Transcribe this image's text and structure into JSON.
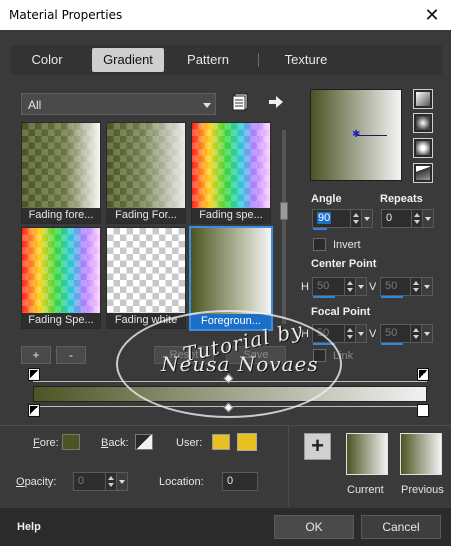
{
  "window": {
    "title": "Material Properties",
    "close_glyph": "✕"
  },
  "tabs": [
    {
      "label": "Color",
      "active": false
    },
    {
      "label": "Gradient",
      "active": true
    },
    {
      "label": "Pattern",
      "active": false
    },
    {
      "label": "Texture",
      "active": false
    }
  ],
  "category": {
    "selected": "All"
  },
  "gallery": [
    {
      "label": "Fading fore...",
      "selected": false
    },
    {
      "label": "Fading For...",
      "selected": false
    },
    {
      "label": "Fading spe...",
      "selected": false
    },
    {
      "label": "Fading Spe...",
      "selected": false
    },
    {
      "label": "Fading white",
      "selected": false
    },
    {
      "label": "Foregroun...",
      "selected": true
    }
  ],
  "style_icons": [
    "linear-style-icon",
    "rectangular-style-icon",
    "sunburst-style-icon",
    "radial-style-icon"
  ],
  "angle": {
    "label": "Angle",
    "value": "90"
  },
  "repeats": {
    "label": "Repeats",
    "value": "0"
  },
  "invert": {
    "label": "Invert",
    "checked": false
  },
  "center_point": {
    "label": "Center Point",
    "h_label": "H",
    "h_value": "50",
    "v_label": "V",
    "v_value": "50"
  },
  "focal_point": {
    "label": "Focal Point",
    "h_label": "H",
    "h_value": "50",
    "v_label": "V",
    "v_value": "50"
  },
  "link": {
    "label": "Link",
    "checked": false
  },
  "gradient_edit": {
    "add_label": "+",
    "remove_label": "-",
    "reset_label": "Reset",
    "save_label": "Save"
  },
  "bottom": {
    "fore_label": "Fore:",
    "back_label": "Back:",
    "user_label": "User:",
    "opacity_label": "Opacity:",
    "opacity_value": "0",
    "location_label": "Location:",
    "location_value": "0",
    "current_label": "Current",
    "previous_label": "Previous",
    "add_swatch_label": "+"
  },
  "footer": {
    "help_label": "Help",
    "ok_label": "OK",
    "cancel_label": "Cancel"
  },
  "watermark": {
    "line1": "Tutorial by",
    "line2": "Neusa Novaes"
  },
  "colors": {
    "fore": "#4b5523",
    "back": "#f2f2f2",
    "user": "#e8c020",
    "accent": "#1c6fc7"
  }
}
